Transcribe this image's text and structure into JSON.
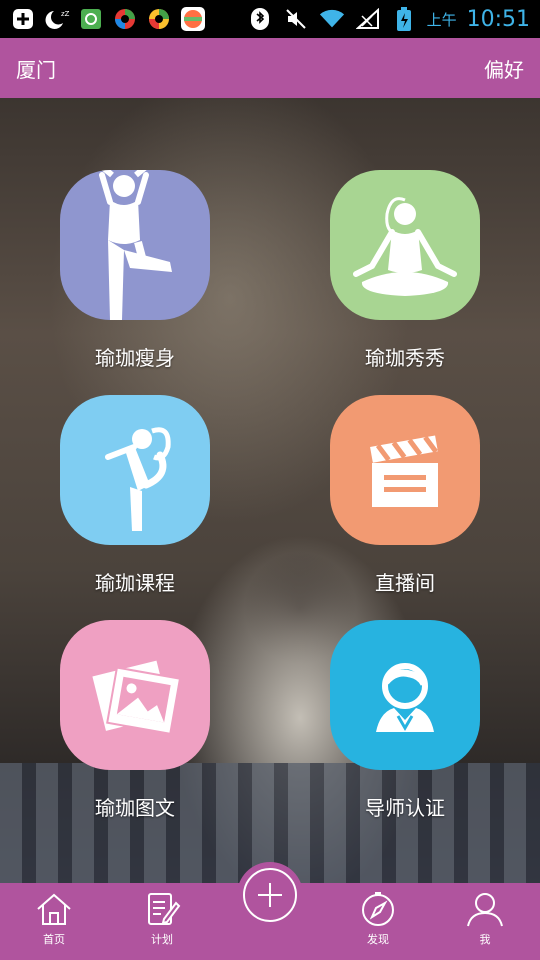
{
  "status_bar": {
    "ampm": "上午",
    "time": "10:51"
  },
  "header": {
    "city": "厦门",
    "preferences": "偏好"
  },
  "tiles": [
    {
      "label": "瑜珈瘦身",
      "color": "#8f96cf",
      "icon": "yoga-tree-pose-icon"
    },
    {
      "label": "瑜珈秀秀",
      "color": "#a8d592",
      "icon": "yoga-lotus-pose-icon"
    },
    {
      "label": "瑜珈课程",
      "color": "#7fcdf2",
      "icon": "yoga-dancer-pose-icon"
    },
    {
      "label": "直播间",
      "color": "#f29a72",
      "icon": "clapperboard-icon"
    },
    {
      "label": "瑜珈图文",
      "color": "#efa0c2",
      "icon": "photo-gallery-icon"
    },
    {
      "label": "导师认证",
      "color": "#27b3e0",
      "icon": "instructor-icon"
    }
  ],
  "bottom_nav": {
    "home": "首页",
    "plan": "计划",
    "discover": "发现",
    "me": "我"
  },
  "colors": {
    "brand": "#b0549e",
    "status_accent": "#3fb4e8"
  }
}
